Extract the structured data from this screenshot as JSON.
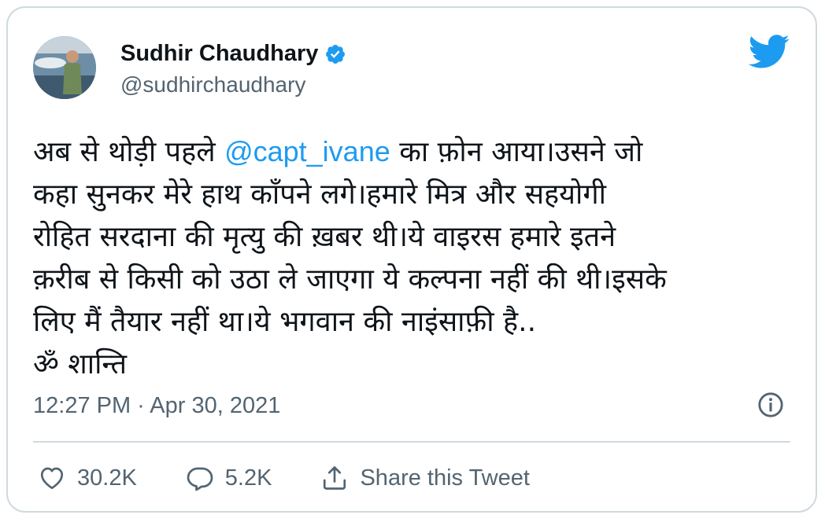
{
  "author": {
    "display_name": "Sudhir Chaudhary",
    "handle": "@sudhirchaudhary",
    "verified": true
  },
  "tweet": {
    "lines": [
      {
        "before": "अब से थोड़ी पहले ",
        "mention": "@capt_ivane",
        "after": " का फ़ोन आया।उसने जो"
      },
      "कहा सुनकर मेरे हाथ काँपने लगे।हमारे मित्र और सहयोगी",
      "रोहित सरदाना की मृत्यु की ख़बर थी।ये वाइरस हमारे इतने",
      "क़रीब से किसी को उठा ले जाएगा ये कल्पना नहीं की थी।इसके",
      "लिए मैं तैयार नहीं था।ये भगवान की नाइंसाफ़ी है..",
      "ॐ शान्ति"
    ],
    "timestamp": "12:27 PM · Apr 30, 2021"
  },
  "actions": {
    "likes": "30.2K",
    "replies": "5.2K",
    "share_label": "Share this Tweet"
  },
  "colors": {
    "accent": "#1d9bf0",
    "text": "#0f1419",
    "secondary": "#536471",
    "border": "#cfd9de"
  },
  "icons": [
    "avatar",
    "verified-badge-icon",
    "twitter-logo-icon",
    "info-icon",
    "heart-icon",
    "reply-icon",
    "share-icon"
  ]
}
